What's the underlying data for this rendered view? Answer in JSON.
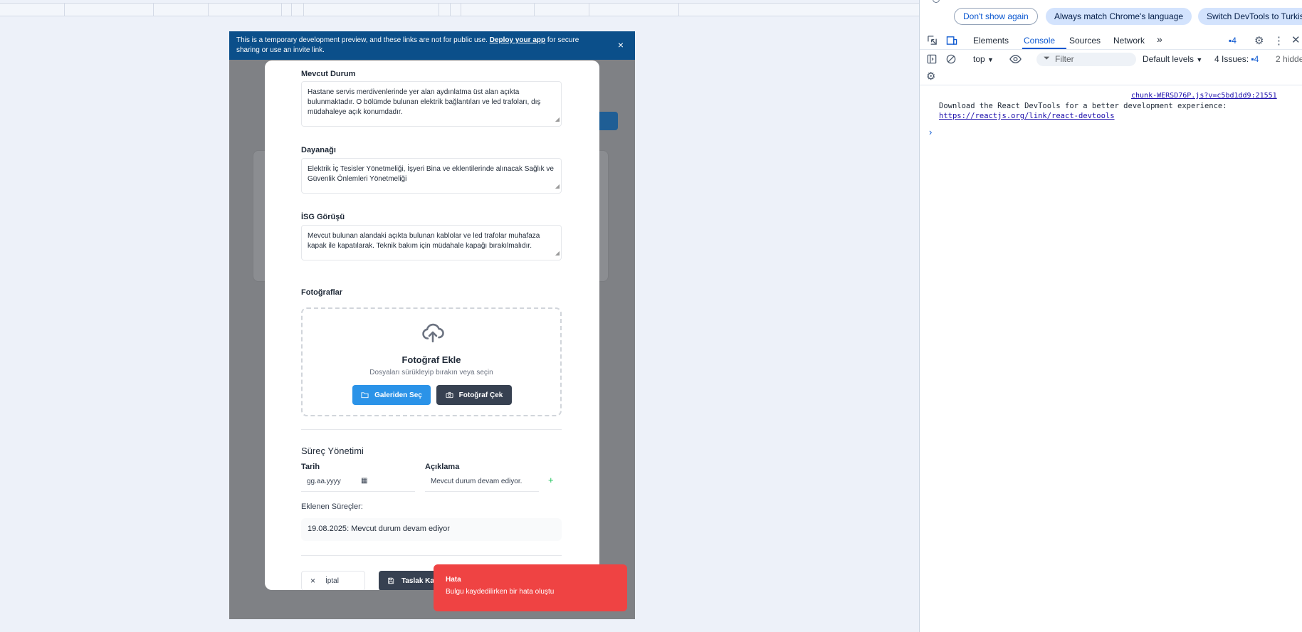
{
  "banner": {
    "text_before": "This is a temporary development preview, and these links are not for public use.",
    "link": "Deploy your app",
    "text_after": "for secure sharing or use an invite link.",
    "close": "×"
  },
  "form": {
    "current_status": {
      "label": "Mevcut Durum",
      "value": "Hastane servis merdivenlerinde yer alan aydınlatma üst alan açıkta bulunmaktadır. O bölümde bulunan elektrik bağlantıları ve led trafoları, dış müdahaleye açık konumdadır."
    },
    "basis": {
      "label": "Dayanağı",
      "value": "Elektrik İç Tesisler Yönetmeliği, İşyeri Bina ve eklentilerinde alınacak Sağlık ve Güvenlik Önlemleri Yönetmeliği"
    },
    "isg_opinion": {
      "label": "İSG Görüşü",
      "value": "Mevcut bulunan alandaki açıkta bulunan kablolar ve led trafolar muhafaza kapak ile kapatılarak. Teknik bakım için müdahale kapağı bırakılmalıdır."
    },
    "photos": {
      "label": "Fotoğraflar",
      "title": "Fotoğraf Ekle",
      "subtitle": "Dosyaları sürükleyip bırakın veya seçin",
      "gallery_button": "Galeriden Seç",
      "camera_button": "Fotoğraf Çek"
    },
    "process": {
      "title": "Süreç Yönetimi",
      "date_label": "Tarih",
      "date_placeholder": "gg.aa.yyyy",
      "desc_label": "Açıklama",
      "desc_value": "Mevcut durum devam ediyor.",
      "add_symbol": "+",
      "added_label": "Eklenen Süreçler:",
      "items": [
        {
          "date": "19.08.2025",
          "text": "Mevcut durum devam ediyor"
        }
      ]
    },
    "footer": {
      "cancel": "İptal",
      "draft": "Taslak Ka"
    }
  },
  "toast": {
    "title": "Hata",
    "message": "Bulgu kaydedilirken bir hata oluştu"
  },
  "devtools": {
    "infobar": {
      "dont_show": "Don't show again",
      "always_match": "Always match Chrome's language",
      "switch": "Switch DevTools to Turkis"
    },
    "tabs": [
      "Elements",
      "Console",
      "Sources",
      "Network"
    ],
    "more_tabs": "»",
    "messages_count": "4",
    "toolbar": {
      "context": "top",
      "filter_placeholder": "Filter",
      "levels": "Default levels",
      "issues_label": "4 Issues:",
      "issues_count": "4",
      "hidden": "2 hidde"
    },
    "console": {
      "source": "chunk-WERSD76P.js?v=c5bd1dd9:21551",
      "message": "Download the React DevTools for a better development experience:",
      "link": "https://reactjs.org/link/react-devtools",
      "prompt": "›"
    }
  },
  "colors": {
    "banner": "#0b4f8a",
    "toast": "#ef4343",
    "primary_button": "#2b93e8",
    "dark_button": "#374151",
    "devtools_accent": "#0b57d0"
  }
}
